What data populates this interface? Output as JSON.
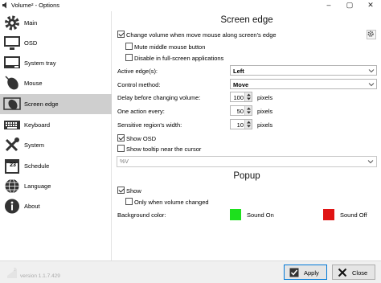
{
  "window": {
    "title": "Volume² - Options",
    "controls": [
      "minimize",
      "maximize",
      "close"
    ]
  },
  "sidebar": {
    "items": [
      {
        "label": "Main",
        "icon": "gear-icon"
      },
      {
        "label": "OSD",
        "icon": "monitor-icon"
      },
      {
        "label": "System tray",
        "icon": "tray-icon"
      },
      {
        "label": "Mouse",
        "icon": "mouse-icon"
      },
      {
        "label": "Screen edge",
        "icon": "mouse-pointer-icon",
        "active": true
      },
      {
        "label": "Keyboard",
        "icon": "keyboard-icon"
      },
      {
        "label": "System",
        "icon": "tools-icon"
      },
      {
        "label": "Schedule",
        "icon": "calendar-icon",
        "day": "23"
      },
      {
        "label": "Language",
        "icon": "globe-icon"
      },
      {
        "label": "About",
        "icon": "info-icon"
      }
    ]
  },
  "screen_edge": {
    "title": "Screen edge",
    "change_volume": {
      "label": "Change volume when move mouse along screen's edge",
      "checked": true
    },
    "mute_middle": {
      "label": "Mute middle mouse button",
      "checked": false
    },
    "disable_fullscreen": {
      "label": "Disable in full-screen applications",
      "checked": false
    },
    "active_edges": {
      "label": "Active edge(s):",
      "value": "Left"
    },
    "control_method": {
      "label": "Control method:",
      "value": "Move"
    },
    "delay": {
      "label": "Delay before changing volume:",
      "value": "100",
      "unit": "pixels"
    },
    "one_action": {
      "label": "One action every:",
      "value": "50",
      "unit": "pixels"
    },
    "sensitive_width": {
      "label": "Sensitive region's width:",
      "value": "10",
      "unit": "pixels"
    },
    "show_osd": {
      "label": "Show OSD",
      "checked": true
    },
    "show_tooltip": {
      "label": "Show tooltip near the cursor",
      "checked": false
    },
    "tooltip_format": {
      "value": "%V"
    }
  },
  "popup": {
    "title": "Popup",
    "show": {
      "label": "Show",
      "checked": true
    },
    "only_changed": {
      "label": "Only when volume changed",
      "checked": false
    },
    "bg_color": {
      "label": "Background color:",
      "sound_on": {
        "label": "Sound On",
        "color": "#1de01d"
      },
      "sound_off": {
        "label": "Sound Off",
        "color": "#e01414"
      }
    }
  },
  "footer": {
    "version": "version 1.1.7.429",
    "apply": "Apply",
    "close": "Close"
  },
  "colors": {
    "accent": "#0078d7",
    "active_nav": "#cfcfcf"
  }
}
